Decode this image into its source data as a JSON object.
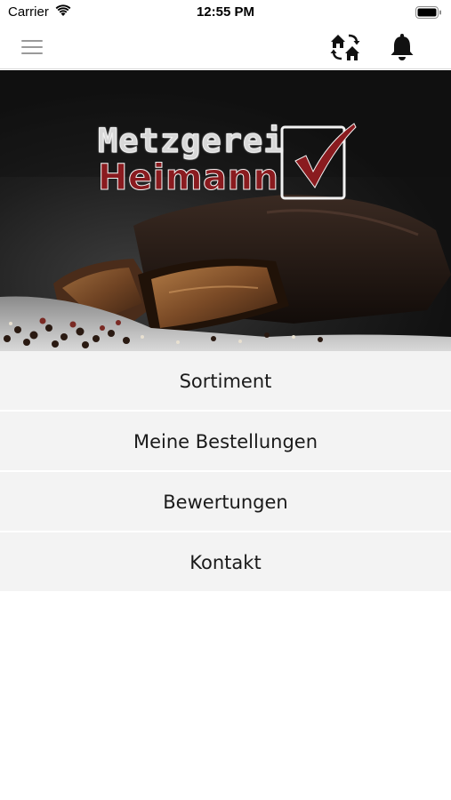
{
  "status_bar": {
    "carrier": "Carrier",
    "time": "12:55 PM"
  },
  "nav_bar": {
    "menu_icon": "hamburger-menu-icon",
    "switch_icon": "switch-store-icon",
    "notification_icon": "bell-icon"
  },
  "hero": {
    "logo_line1": "Metzgerei",
    "logo_line2": "Heimann",
    "colors": {
      "logo_red": "#8a1b1f",
      "logo_silver": "#d8d8d8"
    }
  },
  "menu": {
    "items": [
      {
        "label": "Sortiment"
      },
      {
        "label": "Meine Bestellungen"
      },
      {
        "label": "Bewertungen"
      },
      {
        "label": "Kontakt"
      }
    ]
  }
}
